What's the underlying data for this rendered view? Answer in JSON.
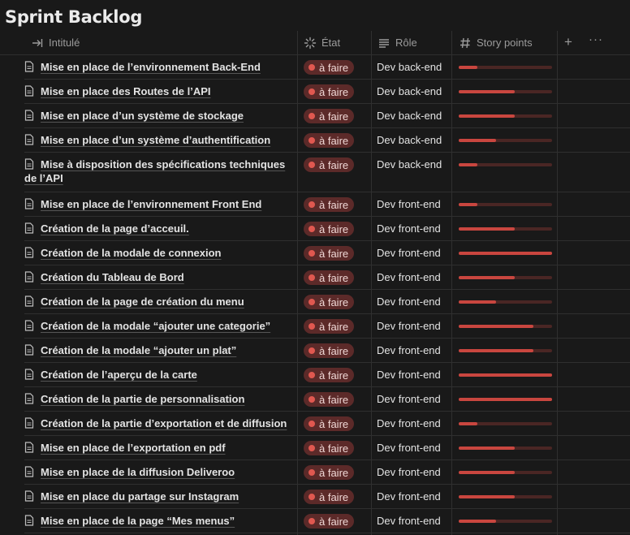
{
  "page": {
    "title": "Sprint Backlog"
  },
  "columns": {
    "title": "Intitulé",
    "status": "État",
    "role": "Rôle",
    "points": "Story points",
    "add": "+",
    "more": "···"
  },
  "rows": [
    {
      "title": "Mise en place de l’environnement Back-End",
      "status": "à faire",
      "role": "Dev back-end",
      "progress": 0.2
    },
    {
      "title": "Mise en place des Routes de l’API",
      "status": "à faire",
      "role": "Dev back-end",
      "progress": 0.6
    },
    {
      "title": "Mise en place d’un système de stockage",
      "status": "à faire",
      "role": "Dev back-end",
      "progress": 0.6
    },
    {
      "title": "Mise en place d’un système d’authentification",
      "status": "à faire",
      "role": "Dev back-end",
      "progress": 0.4
    },
    {
      "title": "Mise à disposition des spécifications techniques de l’API",
      "status": "à faire",
      "role": "Dev back-end",
      "progress": 0.2
    },
    {
      "title": "Mise en place de l’environnement Front End",
      "status": "à faire",
      "role": "Dev front-end",
      "progress": 0.2
    },
    {
      "title": "Création de la page d’acceuil.",
      "status": "à faire",
      "role": "Dev front-end",
      "progress": 0.6
    },
    {
      "title": "Création de la modale de connexion",
      "status": "à faire",
      "role": "Dev front-end",
      "progress": 1.0
    },
    {
      "title": "Création du Tableau de Bord",
      "status": "à faire",
      "role": "Dev front-end",
      "progress": 0.6
    },
    {
      "title": "Création de la page de création du menu",
      "status": "à faire",
      "role": "Dev front-end",
      "progress": 0.4
    },
    {
      "title": "Création de la modale “ajouter une categorie”",
      "status": "à faire",
      "role": "Dev front-end",
      "progress": 0.8
    },
    {
      "title": "Création de la modale “ajouter un plat”",
      "status": "à faire",
      "role": "Dev front-end",
      "progress": 0.8
    },
    {
      "title": "Création de l’aperçu de la carte",
      "status": "à faire",
      "role": "Dev front-end",
      "progress": 1.0
    },
    {
      "title": "Création de la partie de personnalisation",
      "status": "à faire",
      "role": "Dev front-end",
      "progress": 1.0
    },
    {
      "title": "Création de la partie d’exportation et de diffusion",
      "status": "à faire",
      "role": "Dev front-end",
      "progress": 0.2
    },
    {
      "title": "Mise en place de l’exportation en pdf",
      "status": "à faire",
      "role": "Dev front-end",
      "progress": 0.6
    },
    {
      "title": "Mise en place de la diffusion Deliveroo",
      "status": "à faire",
      "role": "Dev front-end",
      "progress": 0.6
    },
    {
      "title": "Mise en place du partage sur Instagram",
      "status": "à faire",
      "role": "Dev front-end",
      "progress": 0.6
    },
    {
      "title": "Mise en place de la page “Mes menus”",
      "status": "à faire",
      "role": "Dev front-end",
      "progress": 0.4
    }
  ],
  "colors": {
    "status_dot": "#e05850",
    "status_bg": "#5c2a29",
    "bar_fill": "#c9463f",
    "bar_track": "#4a2624"
  }
}
